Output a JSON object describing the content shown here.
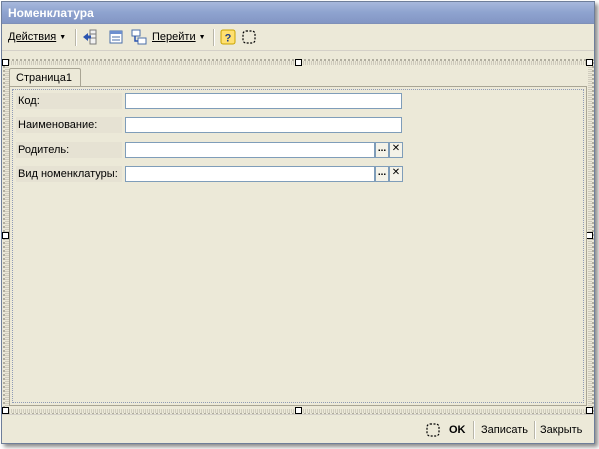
{
  "window": {
    "title": "Номенклатура"
  },
  "toolbar": {
    "actions_label": "Действия",
    "goto_label": "Перейти",
    "icons": [
      "insert-row-icon",
      "list-icon",
      "table-structure-icon",
      "help-icon",
      "frame-select-icon"
    ]
  },
  "tabs": [
    {
      "label": "Страница1"
    }
  ],
  "form": {
    "fields": [
      {
        "label": "Код:",
        "value": ""
      },
      {
        "label": "Наименование:",
        "value": ""
      },
      {
        "label": "Родитель:",
        "value": "",
        "select_btn": "...",
        "clear_btn": "✕"
      },
      {
        "label": "Вид номенклатуры:",
        "value": "",
        "select_btn": "...",
        "clear_btn": "✕"
      }
    ]
  },
  "bottom": {
    "ok_label": "OK",
    "save_label": "Записать",
    "close_label": "Закрыть"
  },
  "colors": {
    "title_bar": "#8ea3cf",
    "window_bg": "#ece9d8",
    "accent_blue": "#2b54b0"
  }
}
